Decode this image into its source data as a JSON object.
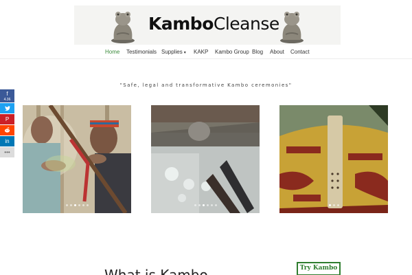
{
  "header": {
    "logo_bold": "Kambo",
    "logo_light": "Cleanse"
  },
  "nav": {
    "items": [
      {
        "label": "Home",
        "active": true
      },
      {
        "label": "Testimonials"
      },
      {
        "label": "Supplies",
        "has_dropdown": true
      },
      {
        "label": "KAKP"
      },
      {
        "label": "Kambo Group"
      },
      {
        "label": "Blog"
      },
      {
        "label": "About"
      },
      {
        "label": "Contact"
      }
    ],
    "dropdown_icon": "chevron-down-icon",
    "active_color": "#3b8a3b"
  },
  "share": {
    "facebook_count": "4.36",
    "facebook_icon": "f",
    "twitter_icon": "twitter-icon",
    "pinterest_icon": "P",
    "reddit_icon": "reddit-icon",
    "linkedin_icon": "in",
    "more_icon": "•••",
    "colors": {
      "facebook": "#3b5998",
      "twitter": "#1da1f2",
      "pinterest": "#cb2027",
      "reddit": "#ff4500",
      "linkedin": "#0077b5"
    }
  },
  "main": {
    "tagline": "\"Safe, legal and transformative Kambo ceremonies\"",
    "section_heading": "What is Kambo",
    "cta_label": "Try Kambo",
    "cta_color": "#2f7d2f"
  },
  "gallery": {
    "sliders": [
      {
        "dots": 6,
        "active": 2
      },
      {
        "dots": 6,
        "active": 2
      },
      {
        "dots": 3,
        "active": 0
      }
    ]
  }
}
